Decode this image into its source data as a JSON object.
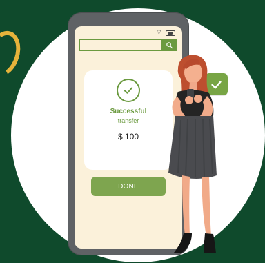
{
  "card": {
    "status_title": "Successful",
    "status_subtitle": "transfer",
    "amount": "$ 100"
  },
  "actions": {
    "done_label": "DONE"
  },
  "icons": {
    "search": "search-icon",
    "wifi": "wifi-icon",
    "battery": "battery-icon",
    "success": "check-icon",
    "badge": "checkbox-icon"
  },
  "colors": {
    "background": "#0f4a2c",
    "circle": "#ffffff",
    "phone": "#5f6265",
    "screen": "#fbf1da",
    "accent": "#6b9a3f",
    "button": "#7ea54f",
    "gold": "#e6b33b"
  }
}
